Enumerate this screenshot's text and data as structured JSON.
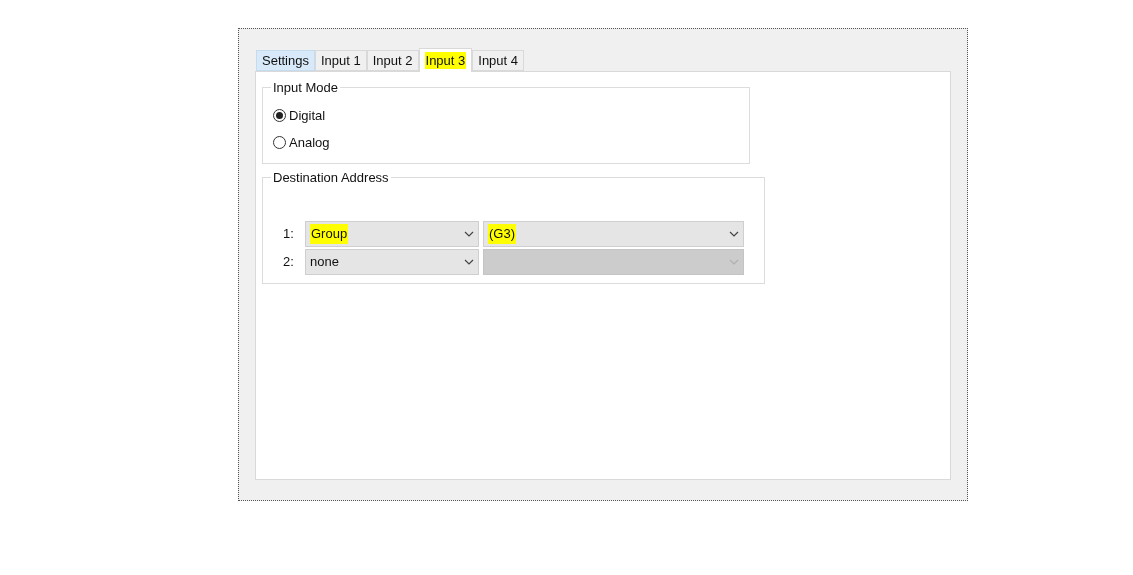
{
  "tabs": [
    {
      "label": "Settings",
      "selected": false,
      "hovered": true,
      "highlighted": false
    },
    {
      "label": "Input 1",
      "selected": false,
      "hovered": false,
      "highlighted": false
    },
    {
      "label": "Input 2",
      "selected": false,
      "hovered": false,
      "highlighted": false
    },
    {
      "label": "Input 3",
      "selected": true,
      "hovered": false,
      "highlighted": true
    },
    {
      "label": "Input 4",
      "selected": false,
      "hovered": false,
      "highlighted": false
    }
  ],
  "input_mode": {
    "title": "Input Mode",
    "options": [
      {
        "label": "Digital",
        "selected": true
      },
      {
        "label": "Analog",
        "selected": false
      }
    ]
  },
  "destination_address": {
    "title": "Destination Address",
    "rows": [
      {
        "label": "1:",
        "type": {
          "value": "Group",
          "highlighted": true
        },
        "target": {
          "value": "(G3)",
          "highlighted": true,
          "disabled": false
        }
      },
      {
        "label": "2:",
        "type": {
          "value": "none",
          "highlighted": false
        },
        "target": {
          "disabled": true
        }
      }
    ]
  }
}
